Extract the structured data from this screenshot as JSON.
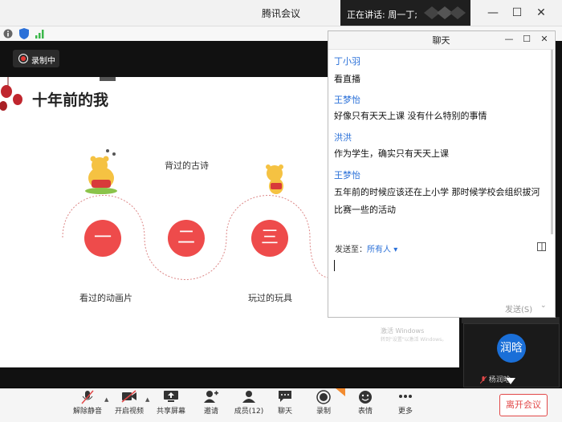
{
  "app": {
    "title": "腾讯会议"
  },
  "speaking": {
    "text": "正在讲话: 周一丁;"
  },
  "recording_badge": {
    "label": "录制中"
  },
  "slide": {
    "title": "十年前的我",
    "items": [
      {
        "num": "一",
        "label": "看过的动画片"
      },
      {
        "num": "二",
        "label": "背过的古诗"
      },
      {
        "num": "三",
        "label": "玩过的玩具"
      }
    ],
    "watermark_line1": "激活 Windows",
    "watermark_line2": "转到\"设置\"以激活 Windows。"
  },
  "participant": {
    "avatar_text": "润晗",
    "name": "杨润晗"
  },
  "chat": {
    "title": "聊天",
    "messages": [
      {
        "sender": "丁小羽",
        "text": "看直播"
      },
      {
        "sender": "王梦怡",
        "text": "好像只有天天上课 没有什么特别的事情"
      },
      {
        "sender": "洪洪",
        "text": "作为学生，确实只有天天上课"
      },
      {
        "sender": "王梦怡",
        "text": "五年前的时候应该还在上小学 那时候学校会组织拔河比赛一些的活动"
      }
    ],
    "send_to_label": "发送至：",
    "send_to_value": "所有人",
    "send_button": "发送(S)"
  },
  "toolbar": {
    "mute": "解除静音",
    "video": "开启视频",
    "share": "共享屏幕",
    "invite": "邀请",
    "members": "成员(12)",
    "chat": "聊天",
    "record": "录制",
    "reactions": "表情",
    "more": "更多",
    "leave": "离开会议"
  },
  "colors": {
    "accent_red": "#ee4b4b",
    "link_blue": "#2a70d8",
    "avatar_blue": "#1a6fd8"
  }
}
